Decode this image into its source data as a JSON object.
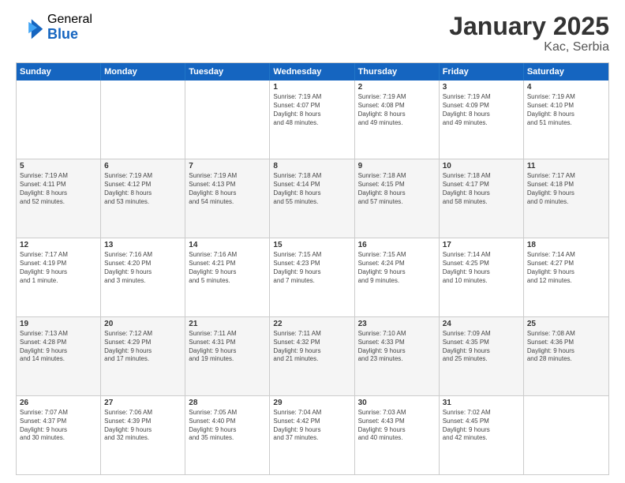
{
  "header": {
    "logo_general": "General",
    "logo_blue": "Blue",
    "title": "January 2025",
    "location": "Kac, Serbia"
  },
  "weekdays": [
    "Sunday",
    "Monday",
    "Tuesday",
    "Wednesday",
    "Thursday",
    "Friday",
    "Saturday"
  ],
  "rows": [
    [
      {
        "day": "",
        "text": ""
      },
      {
        "day": "",
        "text": ""
      },
      {
        "day": "",
        "text": ""
      },
      {
        "day": "1",
        "text": "Sunrise: 7:19 AM\nSunset: 4:07 PM\nDaylight: 8 hours\nand 48 minutes."
      },
      {
        "day": "2",
        "text": "Sunrise: 7:19 AM\nSunset: 4:08 PM\nDaylight: 8 hours\nand 49 minutes."
      },
      {
        "day": "3",
        "text": "Sunrise: 7:19 AM\nSunset: 4:09 PM\nDaylight: 8 hours\nand 49 minutes."
      },
      {
        "day": "4",
        "text": "Sunrise: 7:19 AM\nSunset: 4:10 PM\nDaylight: 8 hours\nand 51 minutes."
      }
    ],
    [
      {
        "day": "5",
        "text": "Sunrise: 7:19 AM\nSunset: 4:11 PM\nDaylight: 8 hours\nand 52 minutes."
      },
      {
        "day": "6",
        "text": "Sunrise: 7:19 AM\nSunset: 4:12 PM\nDaylight: 8 hours\nand 53 minutes."
      },
      {
        "day": "7",
        "text": "Sunrise: 7:19 AM\nSunset: 4:13 PM\nDaylight: 8 hours\nand 54 minutes."
      },
      {
        "day": "8",
        "text": "Sunrise: 7:18 AM\nSunset: 4:14 PM\nDaylight: 8 hours\nand 55 minutes."
      },
      {
        "day": "9",
        "text": "Sunrise: 7:18 AM\nSunset: 4:15 PM\nDaylight: 8 hours\nand 57 minutes."
      },
      {
        "day": "10",
        "text": "Sunrise: 7:18 AM\nSunset: 4:17 PM\nDaylight: 8 hours\nand 58 minutes."
      },
      {
        "day": "11",
        "text": "Sunrise: 7:17 AM\nSunset: 4:18 PM\nDaylight: 9 hours\nand 0 minutes."
      }
    ],
    [
      {
        "day": "12",
        "text": "Sunrise: 7:17 AM\nSunset: 4:19 PM\nDaylight: 9 hours\nand 1 minute."
      },
      {
        "day": "13",
        "text": "Sunrise: 7:16 AM\nSunset: 4:20 PM\nDaylight: 9 hours\nand 3 minutes."
      },
      {
        "day": "14",
        "text": "Sunrise: 7:16 AM\nSunset: 4:21 PM\nDaylight: 9 hours\nand 5 minutes."
      },
      {
        "day": "15",
        "text": "Sunrise: 7:15 AM\nSunset: 4:23 PM\nDaylight: 9 hours\nand 7 minutes."
      },
      {
        "day": "16",
        "text": "Sunrise: 7:15 AM\nSunset: 4:24 PM\nDaylight: 9 hours\nand 9 minutes."
      },
      {
        "day": "17",
        "text": "Sunrise: 7:14 AM\nSunset: 4:25 PM\nDaylight: 9 hours\nand 10 minutes."
      },
      {
        "day": "18",
        "text": "Sunrise: 7:14 AM\nSunset: 4:27 PM\nDaylight: 9 hours\nand 12 minutes."
      }
    ],
    [
      {
        "day": "19",
        "text": "Sunrise: 7:13 AM\nSunset: 4:28 PM\nDaylight: 9 hours\nand 14 minutes."
      },
      {
        "day": "20",
        "text": "Sunrise: 7:12 AM\nSunset: 4:29 PM\nDaylight: 9 hours\nand 17 minutes."
      },
      {
        "day": "21",
        "text": "Sunrise: 7:11 AM\nSunset: 4:31 PM\nDaylight: 9 hours\nand 19 minutes."
      },
      {
        "day": "22",
        "text": "Sunrise: 7:11 AM\nSunset: 4:32 PM\nDaylight: 9 hours\nand 21 minutes."
      },
      {
        "day": "23",
        "text": "Sunrise: 7:10 AM\nSunset: 4:33 PM\nDaylight: 9 hours\nand 23 minutes."
      },
      {
        "day": "24",
        "text": "Sunrise: 7:09 AM\nSunset: 4:35 PM\nDaylight: 9 hours\nand 25 minutes."
      },
      {
        "day": "25",
        "text": "Sunrise: 7:08 AM\nSunset: 4:36 PM\nDaylight: 9 hours\nand 28 minutes."
      }
    ],
    [
      {
        "day": "26",
        "text": "Sunrise: 7:07 AM\nSunset: 4:37 PM\nDaylight: 9 hours\nand 30 minutes."
      },
      {
        "day": "27",
        "text": "Sunrise: 7:06 AM\nSunset: 4:39 PM\nDaylight: 9 hours\nand 32 minutes."
      },
      {
        "day": "28",
        "text": "Sunrise: 7:05 AM\nSunset: 4:40 PM\nDaylight: 9 hours\nand 35 minutes."
      },
      {
        "day": "29",
        "text": "Sunrise: 7:04 AM\nSunset: 4:42 PM\nDaylight: 9 hours\nand 37 minutes."
      },
      {
        "day": "30",
        "text": "Sunrise: 7:03 AM\nSunset: 4:43 PM\nDaylight: 9 hours\nand 40 minutes."
      },
      {
        "day": "31",
        "text": "Sunrise: 7:02 AM\nSunset: 4:45 PM\nDaylight: 9 hours\nand 42 minutes."
      },
      {
        "day": "",
        "text": ""
      }
    ]
  ]
}
